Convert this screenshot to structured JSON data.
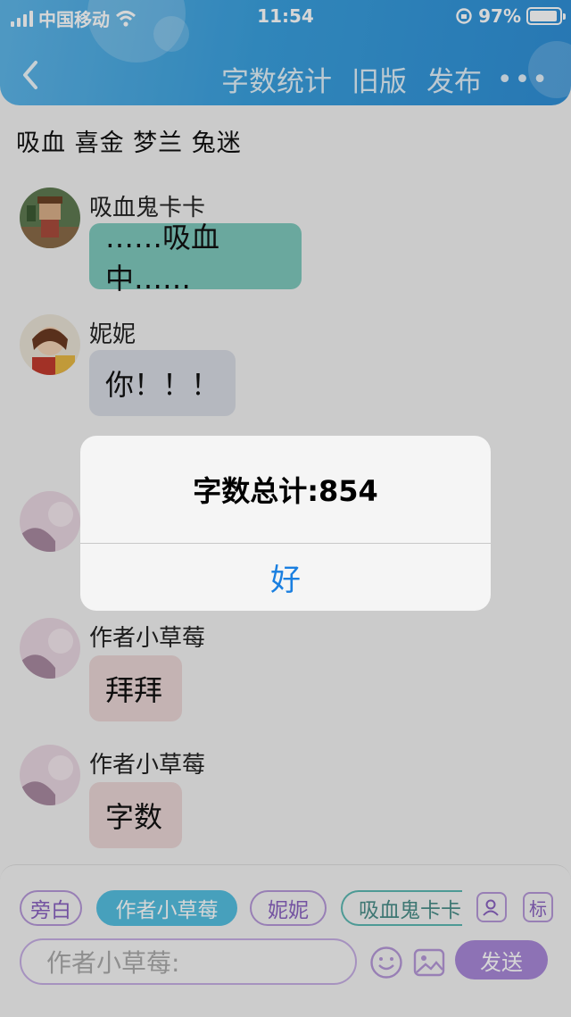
{
  "status_bar": {
    "carrier": "中国移动",
    "time": "11:54",
    "battery": "97%"
  },
  "nav": {
    "actions": [
      "字数统计",
      "旧版",
      "发布"
    ]
  },
  "members_line": "吸血 喜金 梦兰 兔迷",
  "messages": [
    {
      "sender": "吸血鬼卡卡",
      "text": "……吸血中……",
      "bubble_color": "#7fc9bd"
    },
    {
      "sender": "妮妮",
      "text": "你！！！",
      "bubble_color": "#d8dce4"
    },
    {
      "sender": "作者小草莓",
      "text": "拜拜",
      "bubble_color": "#ead6d6"
    },
    {
      "sender": "作者小草莓",
      "text": "字数",
      "bubble_color": "#ead6d6"
    }
  ],
  "alert": {
    "title": "字数总计:854",
    "ok_label": "好"
  },
  "roles": [
    "旁白",
    "作者小草莓",
    "妮妮",
    "吸血鬼卡卡"
  ],
  "tag_label": "标",
  "input": {
    "placeholder": "作者小草莓:"
  },
  "send_label": "发送",
  "colors": {
    "header": "#3aa0de",
    "ios_blue": "#1a7fe0",
    "send": "#a888d8",
    "active_chip": "#55bfe0"
  },
  "icons": [
    "back-icon",
    "more-icon",
    "signal-icon",
    "wifi-icon",
    "battery-icon",
    "role-icon",
    "emoji-icon",
    "image-icon"
  ]
}
